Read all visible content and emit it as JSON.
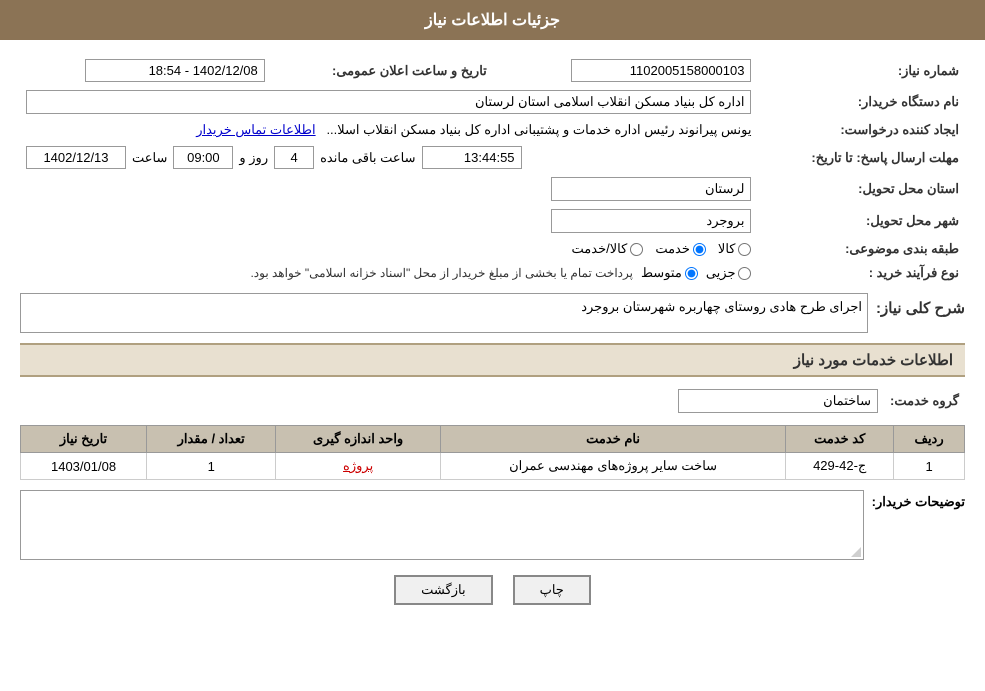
{
  "header": {
    "title": "جزئیات اطلاعات نیاز"
  },
  "fields": {
    "need_number_label": "شماره نیاز:",
    "need_number_value": "1102005158000103",
    "announcement_datetime_label": "تاریخ و ساعت اعلان عمومی:",
    "announcement_datetime_value": "1402/12/08 - 18:54",
    "buyer_org_label": "نام دستگاه خریدار:",
    "buyer_org_value": "اداره کل بنیاد مسکن انقلاب اسلامی استان لرستان",
    "creator_label": "ایجاد کننده درخواست:",
    "creator_value": "یونس پیرانوند رئیس اداره خدمات و پشتیبانی اداره کل بنیاد مسکن انقلاب اسلا...",
    "creator_link": "اطلاعات تماس خریدار",
    "deadline_label": "مهلت ارسال پاسخ: تا تاریخ:",
    "deadline_date": "1402/12/13",
    "deadline_time_label": "ساعت",
    "deadline_time": "09:00",
    "deadline_day_label": "روز و",
    "deadline_days": "4",
    "deadline_remaining_label": "ساعت باقی مانده",
    "deadline_remaining": "13:44:55",
    "province_label": "استان محل تحویل:",
    "province_value": "لرستان",
    "city_label": "شهر محل تحویل:",
    "city_value": "بروجرد",
    "category_label": "طبقه بندی موضوعی:",
    "category_options": [
      "کالا",
      "خدمت",
      "کالا/خدمت"
    ],
    "category_selected": "خدمت",
    "process_type_label": "نوع فرآیند خرید :",
    "process_options": [
      "جزیی",
      "متوسط"
    ],
    "process_note": "پرداخت تمام یا بخشی از مبلغ خریدار از محل \"اسناد خزانه اسلامی\" خواهد بود.",
    "overall_need_label": "شرح کلی نیاز:",
    "overall_need_value": "اجرای طرح هادی روستای  چهاربره  شهرستان بروجرد",
    "services_info_label": "اطلاعات خدمات مورد نیاز",
    "service_group_label": "گروه خدمت:",
    "service_group_value": "ساختمان",
    "table": {
      "headers": [
        "ردیف",
        "کد خدمت",
        "نام خدمت",
        "واحد اندازه گیری",
        "تعداد / مقدار",
        "تاریخ نیاز"
      ],
      "rows": [
        {
          "row": "1",
          "code": "ج-42-429",
          "name": "ساخت سایر پروژه‌های مهندسی عمران",
          "unit": "پروژه",
          "quantity": "1",
          "date": "1403/01/08"
        }
      ]
    },
    "buyer_desc_label": "توضیحات خریدار:",
    "buyer_desc_value": "",
    "buttons": {
      "print": "چاپ",
      "back": "بازگشت"
    }
  }
}
